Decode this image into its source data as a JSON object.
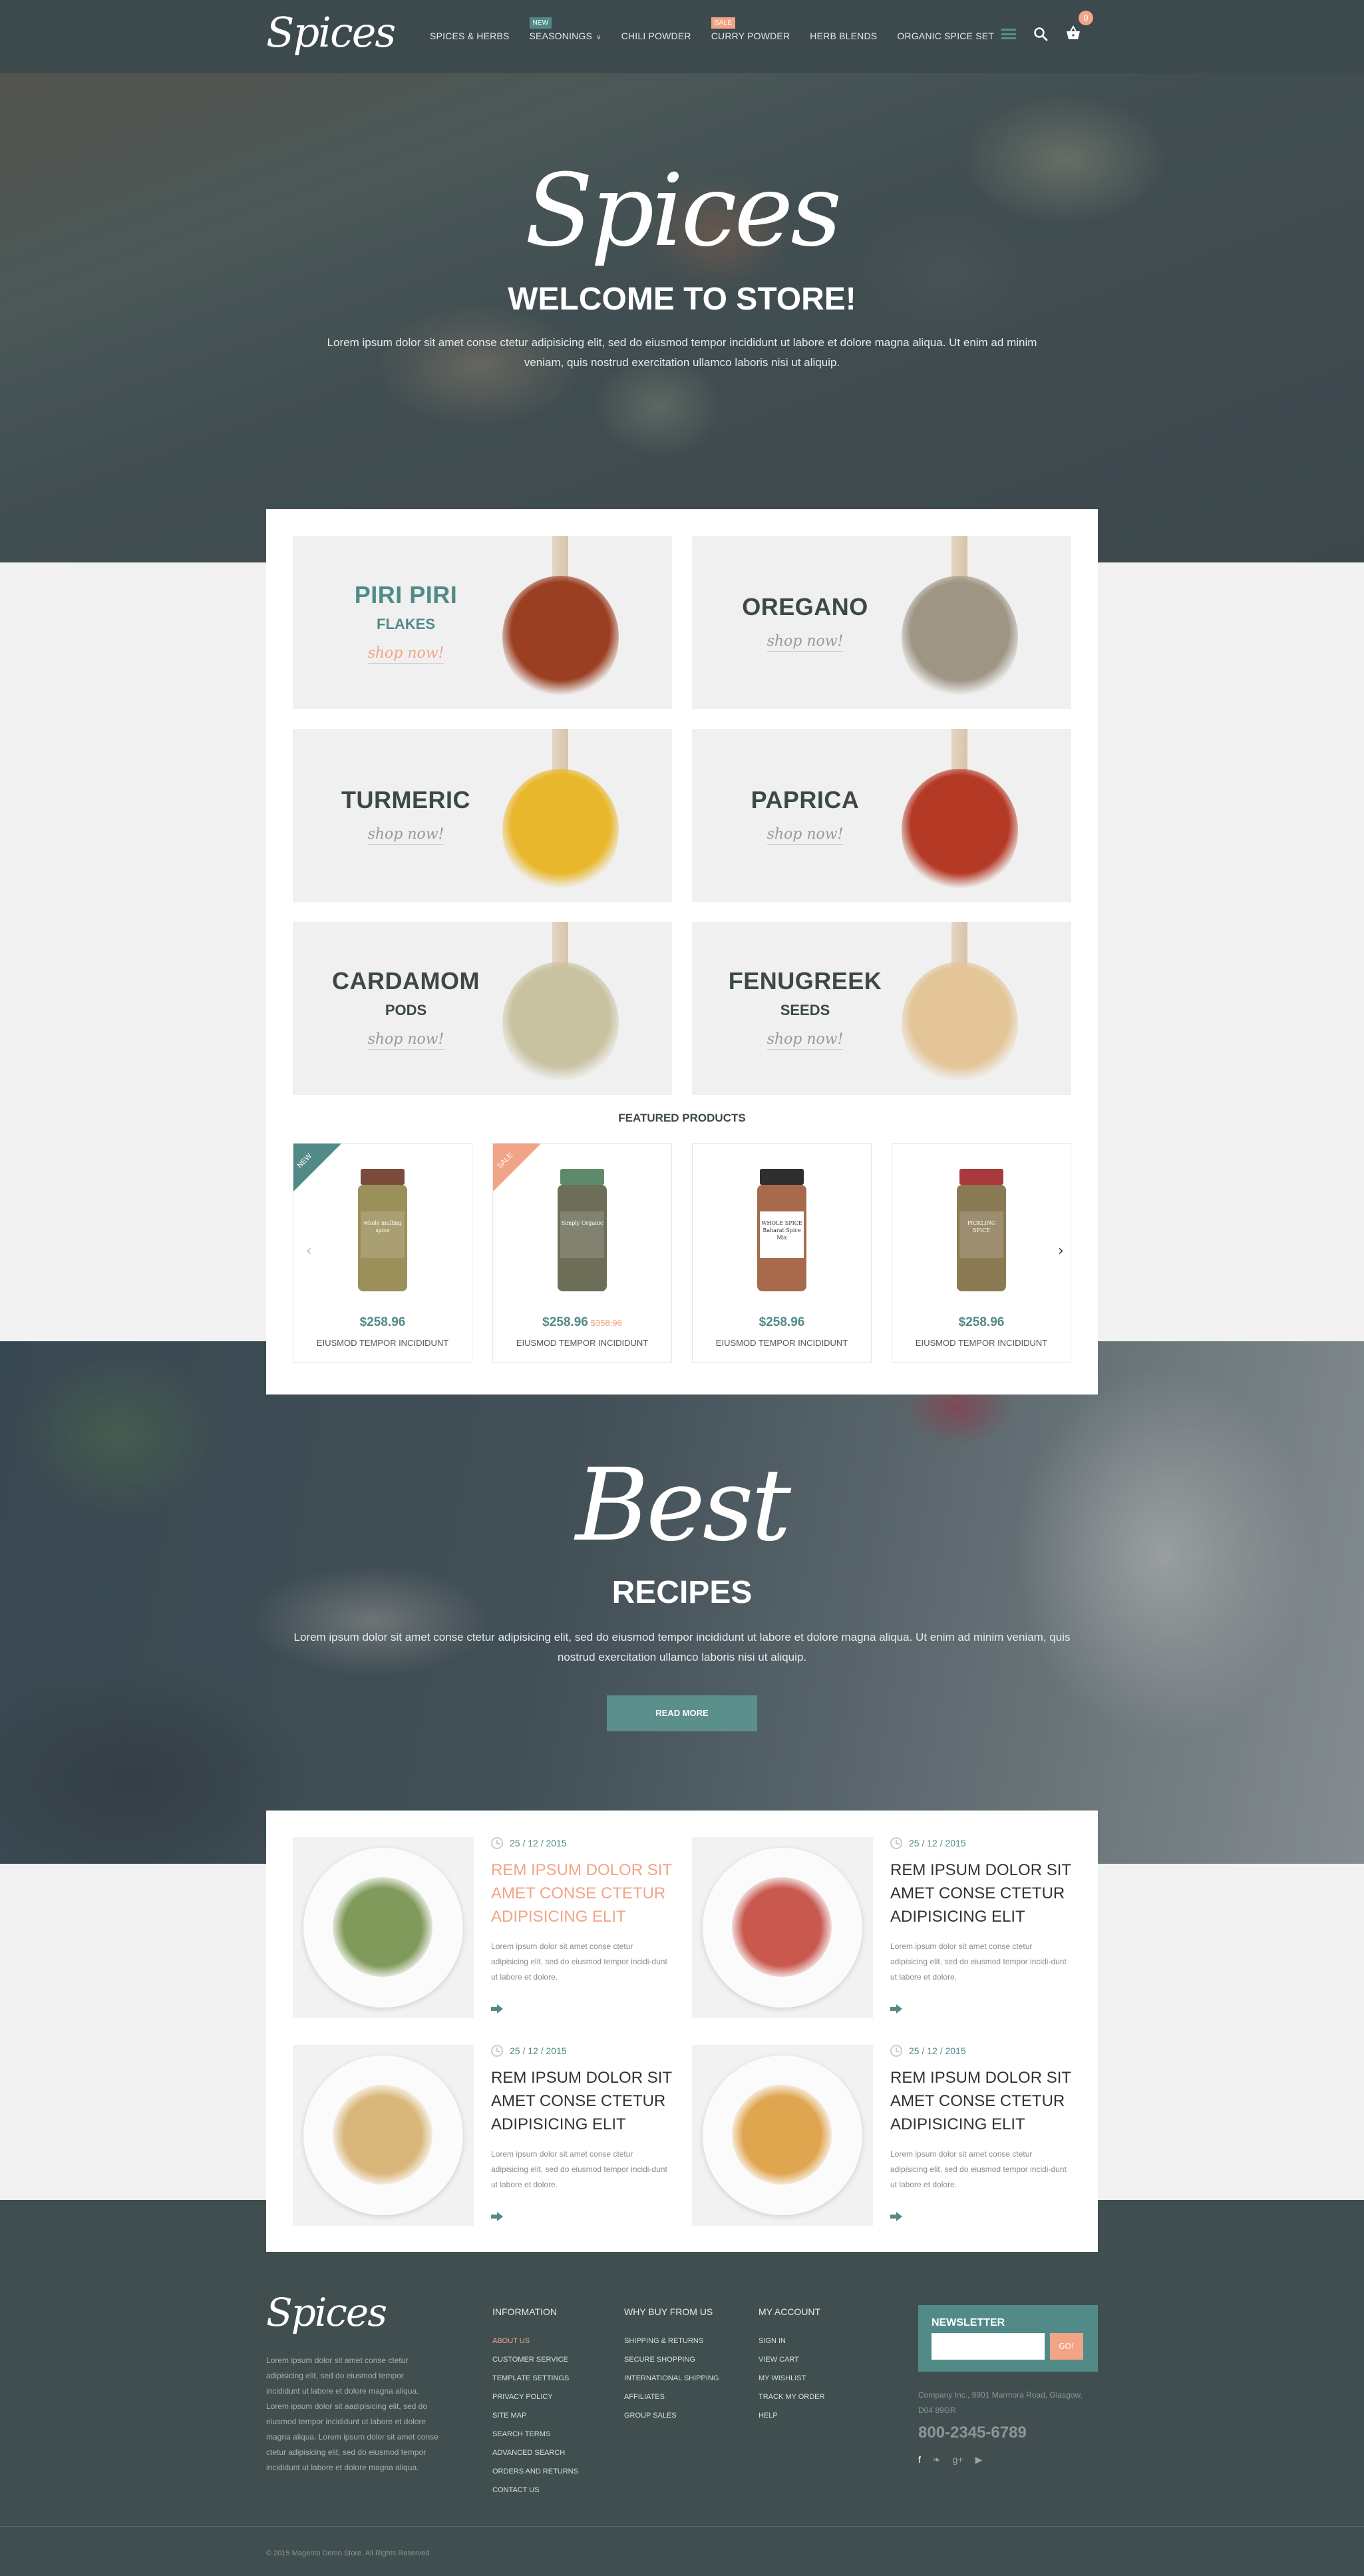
{
  "header": {
    "logo": "Spices",
    "nav": [
      {
        "label": "SPICES & HERBS",
        "badge": null
      },
      {
        "label": "SEASONINGS",
        "badge": "NEW",
        "dropdown": true
      },
      {
        "label": "CHILI POWDER",
        "badge": null
      },
      {
        "label": "CURRY POWDER",
        "badge": "SALE"
      },
      {
        "label": "HERB BLENDS",
        "badge": null
      },
      {
        "label": "ORGANIC SPICE SET",
        "badge": null
      }
    ],
    "icons": [
      "menu-icon",
      "search-icon",
      "cart-icon"
    ],
    "cart_count": "0"
  },
  "hero": {
    "script_title": "Spices",
    "title": "WELCOME TO STORE!",
    "text": "Lorem ipsum dolor sit amet conse ctetur adipisicing elit, sed do eiusmod tempor incididunt ut labore et dolore magna aliqua. Ut enim ad minim veniam, quis nostrud exercitation ullamco laboris nisi ut aliquip."
  },
  "categories": [
    {
      "title": "PIRI PIRI",
      "subtitle": "FLAKES",
      "cta": "shop now!",
      "color": "#9b3f23"
    },
    {
      "title": "OREGANO",
      "subtitle": "",
      "cta": "shop now!",
      "color": "#9e9584"
    },
    {
      "title": "TURMERIC",
      "subtitle": "",
      "cta": "shop now!",
      "color": "#e9b72c"
    },
    {
      "title": "PAPRICA",
      "subtitle": "",
      "cta": "shop now!",
      "color": "#b53a26"
    },
    {
      "title": "CARDAMOM",
      "subtitle": "PODS",
      "cta": "shop now!",
      "color": "#c9c2a1"
    },
    {
      "title": "FENUGREEK",
      "subtitle": "SEEDS",
      "cta": "shop now!",
      "color": "#e3c598"
    }
  ],
  "featured": {
    "title": "FEATURED PRODUCTS",
    "products": [
      {
        "badge": "NEW",
        "badge_color": "#528a88",
        "price": "$258.96",
        "old_price": "",
        "name": "EIUSMOD TEMPOR INCIDIDUNT",
        "label": "whole mulling spice",
        "lid": "#7a4a3a",
        "fill": "#9b8f5a"
      },
      {
        "badge": "SALE",
        "badge_color": "#f2a487",
        "price": "$258.96",
        "old_price": "$358.96",
        "name": "EIUSMOD TEMPOR INCIDIDUNT",
        "label": "Simply Organic",
        "lid": "#5f8a6a",
        "fill": "#6c6e58"
      },
      {
        "badge": "",
        "badge_color": "",
        "price": "$258.96",
        "old_price": "",
        "name": "EIUSMOD TEMPOR INCIDIDUNT",
        "label": "WHOLE SPICE Baharat Spice Mix",
        "lid": "#2e2e2e",
        "fill": "#a86a4c"
      },
      {
        "badge": "",
        "badge_color": "",
        "price": "$258.96",
        "old_price": "",
        "name": "EIUSMOD TEMPOR INCIDIDUNT",
        "label": "PICKLING SPICE",
        "lid": "#a83a3e",
        "fill": "#8b7b55"
      }
    ]
  },
  "recipes_banner": {
    "script_title": "Best",
    "title": "RECIPES",
    "text": "Lorem ipsum dolor sit amet conse ctetur adipisicing elit, sed do eiusmod tempor incididunt ut labore et dolore magna aliqua. Ut enim ad minim veniam, quis nostrud exercitation ullamco laboris nisi ut aliquip.",
    "button": "READ MORE"
  },
  "recipes": [
    {
      "date": "25 / 12 / 2015",
      "title": "REM IPSUM DOLOR SIT AMET CONSE CTETUR ADIPISICING ELIT",
      "text": "Lorem ipsum dolor sit amet conse ctetur adipisicing elit, sed do eiusmod tempor incidi-dunt ut labore et dolore.",
      "highlight": true,
      "food": "#7f9a5a"
    },
    {
      "date": "25 / 12 / 2015",
      "title": "REM IPSUM DOLOR SIT AMET CONSE CTETUR ADIPISICING ELIT",
      "text": "Lorem ipsum dolor sit amet conse ctetur adipisicing elit, sed do eiusmod tempor incidi-dunt ut labore et dolore.",
      "highlight": false,
      "food": "#c9584f"
    },
    {
      "date": "25 / 12 / 2015",
      "title": "REM IPSUM DOLOR SIT AMET CONSE CTETUR ADIPISICING ELIT",
      "text": "Lorem ipsum dolor sit amet conse ctetur adipisicing elit, sed do eiusmod tempor incidi-dunt ut labore et dolore.",
      "highlight": false,
      "food": "#d9b77a"
    },
    {
      "date": "25 / 12 / 2015",
      "title": "REM IPSUM DOLOR SIT AMET CONSE CTETUR ADIPISICING ELIT",
      "text": "Lorem ipsum dolor sit amet conse ctetur adipisicing elit, sed do eiusmod tempor incidi-dunt ut labore et dolore.",
      "highlight": false,
      "food": "#e0a54f"
    }
  ],
  "footer": {
    "logo": "Spices",
    "about": "Lorem ipsum dolor sit amet conse ctetur adipisicing elit, sed do eiusmod tempor incididunt ut labore et dolore magna aliqua. Lorem ipsum dolor sit aadipisicing elit, sed do eiusmod tempor incididunt ut labore et dolore magna aliqua. Lorem ipsum dolor sit amet conse ctetur adipisicing elit, sed do eiusmod tempor incididunt ut labore et dolore magna aliqua.",
    "columns": [
      {
        "title": "INFORMATION",
        "links": [
          "ABOUT US",
          "CUSTOMER SERVICE",
          "TEMPLATE SETTINGS",
          "PRIVACY POLICY",
          "SITE MAP",
          "SEARCH TERMS",
          "ADVANCED SEARCH",
          "ORDERS AND RETURNS",
          "CONTACT US"
        ],
        "active": 0
      },
      {
        "title": "WHY BUY FROM US",
        "links": [
          "SHIPPING & RETURNS",
          "SECURE SHOPPING",
          "INTERNATIONAL SHIPPING",
          "AFFILIATES",
          "GROUP SALES"
        ],
        "active": -1
      },
      {
        "title": "MY ACCOUNT",
        "links": [
          "SIGN IN",
          "VIEW CART",
          "MY WISHLIST",
          "TRACK MY ORDER",
          "HELP"
        ],
        "active": -1
      }
    ],
    "newsletter": {
      "title": "NEWSLETTER",
      "input_value": "",
      "button": "GO!"
    },
    "address": "Company Inc., 8901 Marmora Road, Glasgow, D04 89GR",
    "phone": "800-2345-6789",
    "socials": [
      {
        "name": "facebook-icon",
        "glyph": "f"
      },
      {
        "name": "twitter-icon",
        "glyph": "❧"
      },
      {
        "name": "google-plus-icon",
        "glyph": "g+"
      },
      {
        "name": "youtube-icon",
        "glyph": "▶"
      }
    ],
    "copyright": "© 2015 Magento Demo Store. All Rights Reserved."
  },
  "colors": {
    "teal": "#528a88",
    "peach": "#f2a487",
    "dark": "#404e4f",
    "light_bg": "#f2f2f2"
  }
}
